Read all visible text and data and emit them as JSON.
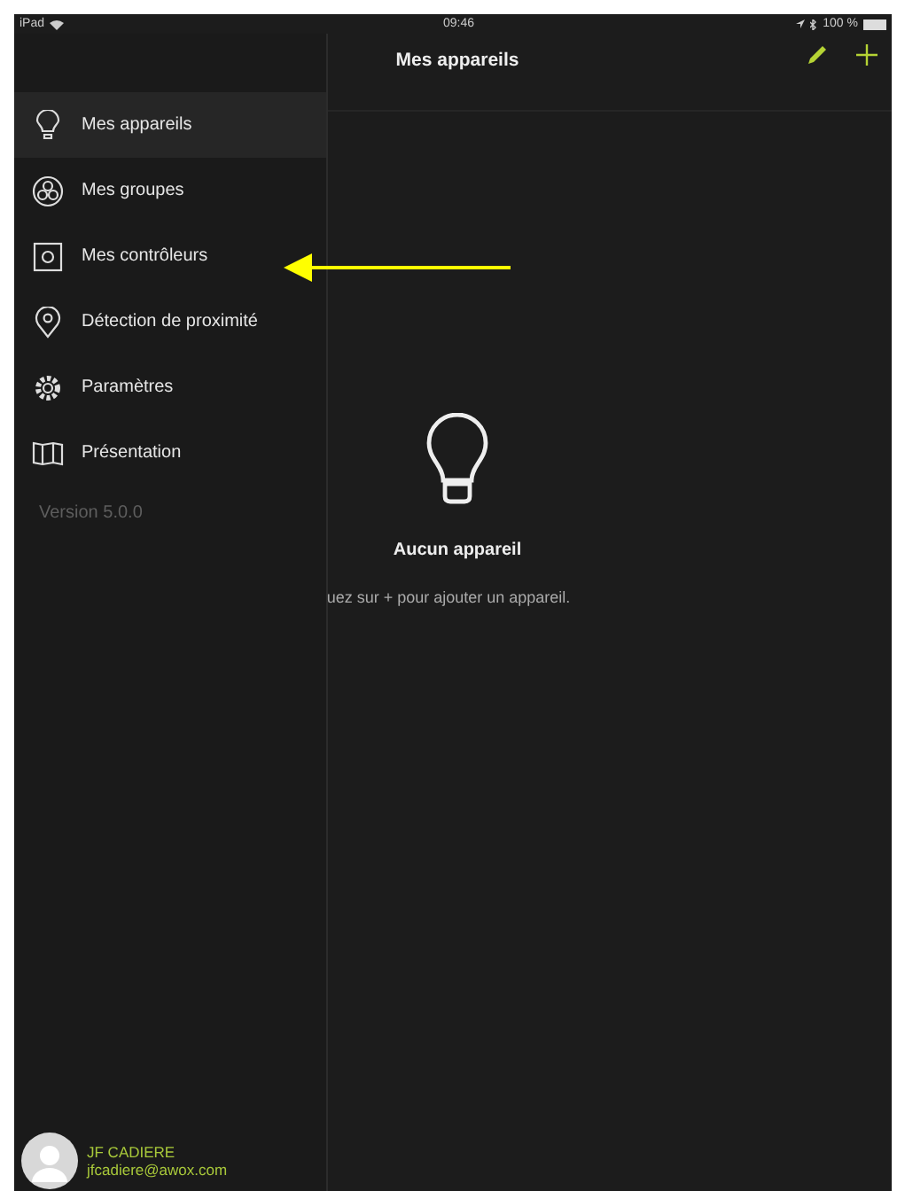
{
  "status_bar": {
    "device": "iPad",
    "time": "09:46",
    "battery": "100 %"
  },
  "sidebar": {
    "items": [
      {
        "label": "Mes appareils",
        "selected": true
      },
      {
        "label": "Mes groupes",
        "selected": false
      },
      {
        "label": "Mes contrôleurs",
        "selected": false
      },
      {
        "label": "Détection de proximité",
        "selected": false
      },
      {
        "label": "Paramètres",
        "selected": false
      },
      {
        "label": "Présentation",
        "selected": false
      }
    ],
    "version": "Version 5.0.0",
    "profile": {
      "name": "JF CADIERE",
      "email": "jfcadiere@awox.com"
    }
  },
  "header": {
    "title": "Mes appareils"
  },
  "empty_state": {
    "title": "Aucun appareil",
    "hint": "uez sur + pour ajouter un appareil."
  }
}
